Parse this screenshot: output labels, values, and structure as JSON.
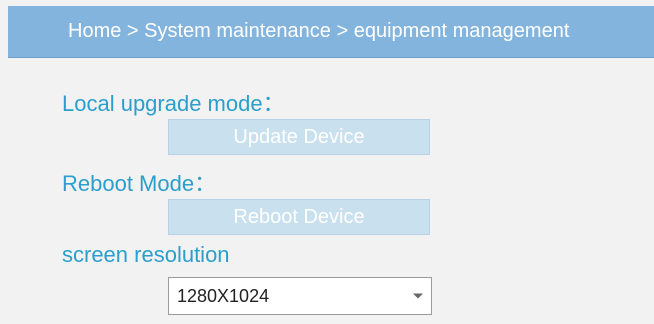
{
  "breadcrumb": {
    "text": "Home > System maintenance > equipment management"
  },
  "sections": {
    "local_upgrade": {
      "label": "Local upgrade mode：",
      "button_label": "Update Device"
    },
    "reboot": {
      "label": "Reboot Mode：",
      "button_label": "Reboot Device"
    },
    "resolution": {
      "label": "screen resolution",
      "selected_value": "1280X1024"
    }
  },
  "colors": {
    "breadcrumb_bg": "#83b4dd",
    "label_text": "#2a9fcc",
    "button_bg": "#c9e0ef",
    "page_bg": "#f2f2f2"
  },
  "icons": {
    "dropdown": "chevron-down-icon"
  }
}
